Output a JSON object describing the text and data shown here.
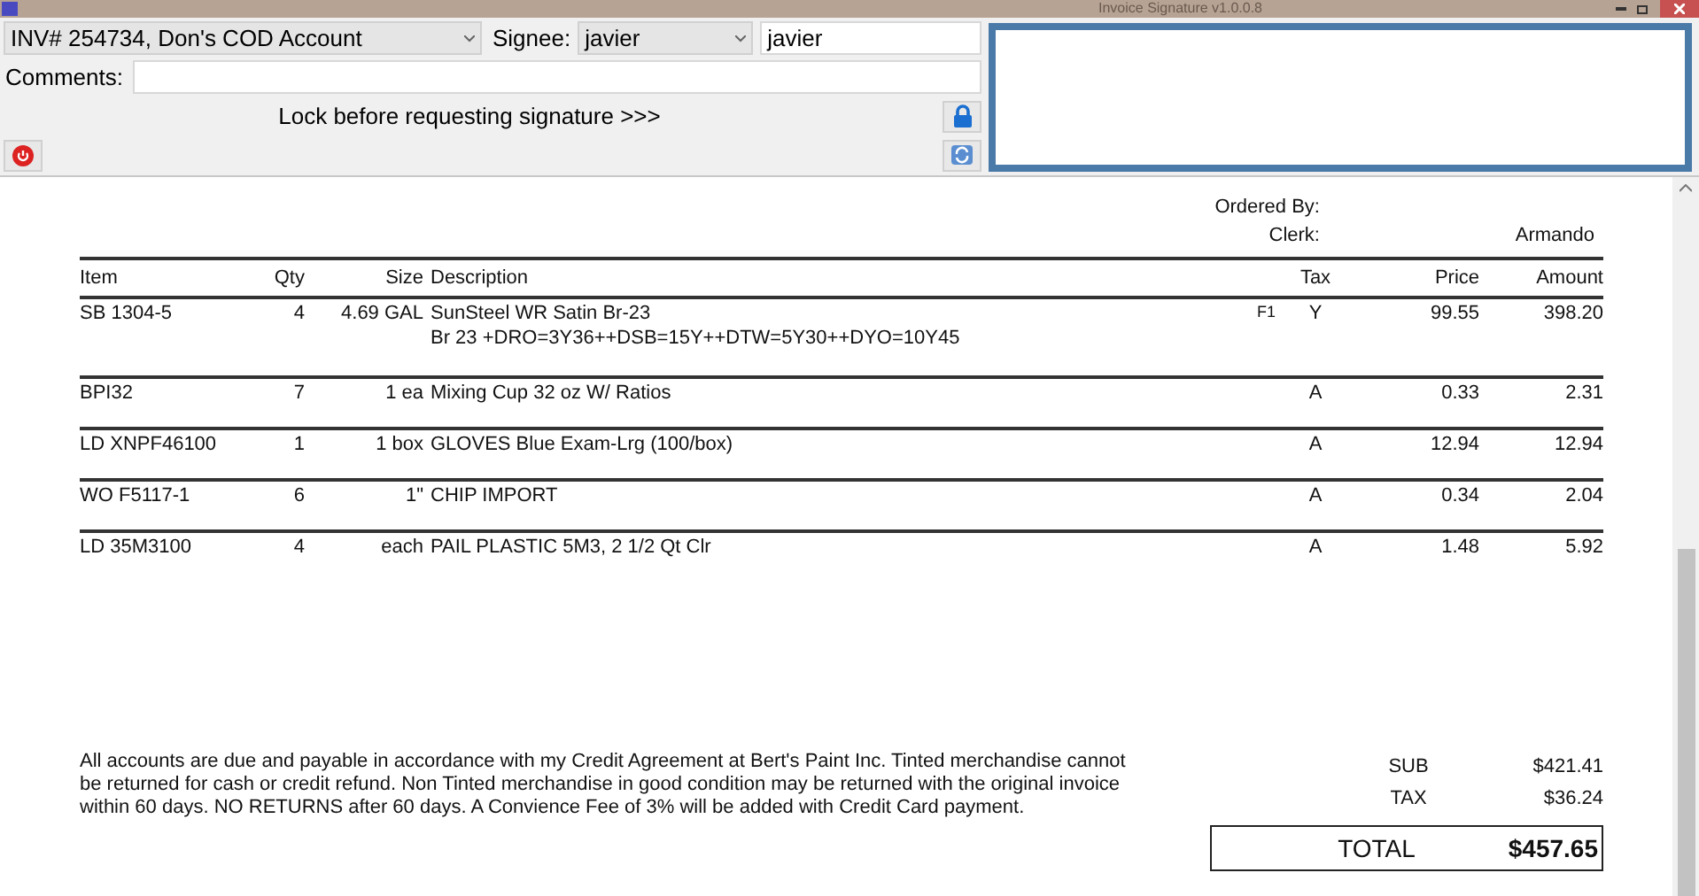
{
  "window": {
    "title": "Invoice Signature v1.0.0.8"
  },
  "toolbar": {
    "invoice_select": "INV# 254734, Don's COD Account",
    "signee_label": "Signee:",
    "signee_select": "javier",
    "signee_name": "javier",
    "comments_label": "Comments:",
    "lock_hint": "Lock before requesting signature >>>"
  },
  "invoice": {
    "ordered_by_label": "Ordered By:",
    "clerk_label": "Clerk:",
    "clerk": "Armando",
    "columns": [
      "Item",
      "Qty",
      "Size",
      "Description",
      "Tax",
      "Price",
      "Amount"
    ],
    "rows": [
      {
        "item": "SB 1304-5",
        "qty": "4",
        "size": "4.69 GAL",
        "description": [
          "SunSteel WR Satin Br-23",
          "Br 23 +DRO=3Y36++DSB=15Y++DTW=5Y30++DYO=10Y45"
        ],
        "flag": "F1",
        "tax": "Y",
        "price": "99.55",
        "amount": "398.20"
      },
      {
        "item": "BPI32",
        "qty": "7",
        "size": "1 ea",
        "description": [
          "Mixing Cup 32 oz W/ Ratios"
        ],
        "tax": "A",
        "price": "0.33",
        "amount": "2.31"
      },
      {
        "item": "LD XNPF46100",
        "qty": "1",
        "size": "1 box",
        "description": [
          "GLOVES Blue Exam-Lrg  (100/box)"
        ],
        "tax": "A",
        "price": "12.94",
        "amount": "12.94"
      },
      {
        "item": "WO F5117-1",
        "qty": "6",
        "size": "1\"",
        "description": [
          "CHIP IMPORT"
        ],
        "tax": "A",
        "price": "0.34",
        "amount": "2.04"
      },
      {
        "item": "LD 35M3100",
        "qty": "4",
        "size": "each",
        "description": [
          "PAIL PLASTIC 5M3, 2 1/2 Qt Clr"
        ],
        "tax": "A",
        "price": "1.48",
        "amount": "5.92"
      }
    ],
    "terms": "All accounts are due and payable in accordance with my Credit Agreement at Bert's Paint Inc. Tinted merchandise cannot be returned for cash or credit refund. Non Tinted merchandise in good condition may be returned with the original invoice within 60 days. NO RETURNS after 60 days. A Convience Fee of 3% will be added with Credit Card payment.",
    "sub_label": "SUB",
    "sub": "$421.41",
    "tax_label": "TAX",
    "tax": "$36.24",
    "total_label": "TOTAL",
    "total": "$457.65"
  }
}
